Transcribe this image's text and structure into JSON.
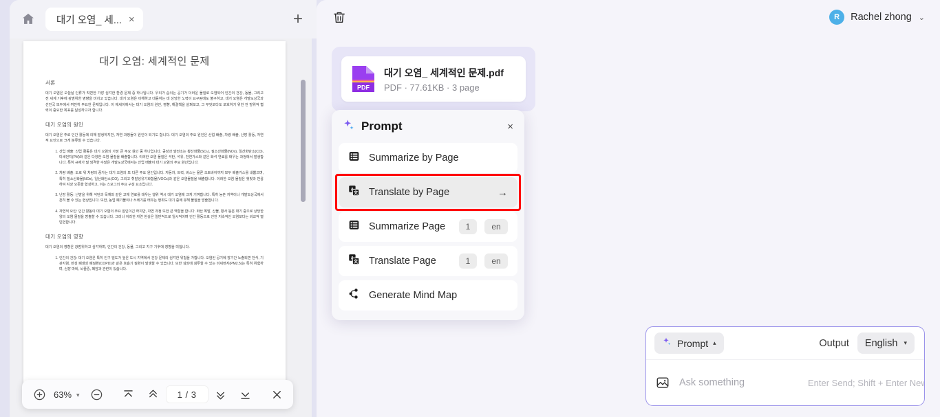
{
  "tabbar": {
    "home_icon": "home-icon",
    "tab_title": "대기 오염_ 세...",
    "tab_close": "×",
    "add_tab": "+"
  },
  "document": {
    "title": "대기 오염: 세계적인 문제",
    "sections": [
      {
        "heading": "서론",
        "paragraphs": [
          "대기 오염은 오늘날 인류가 직면한 가장 심각한 환경 문제 중 하나입니다. 우리가 숨쉬는 공기가 더러운 물질로 오염되어 인간의 건강, 동물, 그리고 전 세계 기후에 광범위한 영향을 미치고 있습니다. 대기 오염은 이해하고 대응하는 데 상당한 노력이 요구됨에도 불구하고, 대기 오염은 개발도상국과 선진국 모두에서 여전히 주요한 문제입니다. 이 에세이에서는 대기 오염의 원인, 영향, 해결책을 살펴보고, 그 무엇보다도 보호하기 위한 전 방위적 협력이 중요한 목표를 달성하고자 합니다."
        ],
        "list": []
      },
      {
        "heading": "대기 오염의 원인",
        "paragraphs": [
          "대기 오염은 주로 인간 활동에 의해 발생하지만, 자연 과정들이 원인이 되기도 합니다. 대기 오염의 주요 원인은 산업 배출, 차량 배출, 난방 활동, 자연적 요인으로 크게 분류할 수 있습니다."
        ],
        "list": [
          "산업 배출: 산업 활동은 대기 오염의 가장 큰 주요 원인 중 하나입니다. 공장과 발전소는 황산화물(SO₂), 질소산화물(NOx), 일산화탄소(CO), 미세먼지(PM)와 같은 다양한 오염 물질을 배출합니다. 이러한 오염 물질은 석탄, 석유, 천연가스와 같은 화석 연료를 태우는 과정에서 발생합니다. 특히 규제가 덜 엄격한 수많은 개발도상국에서는 산업 배출이 대기 오염의 주요 원인입니다.",
          "차량 배출: 도로 위 차량의 증가는 대기 오염의 또 다른 주요 원인입니다. 자동차, 트럭, 버스는 물론 오토바이까지 모두 배출가스를 내뿜으며, 특히 질소산화물(NOx), 일산화탄소(CO), 그리고 휘발성유기화합물(VOCs)과 같은 오염물질을 배출합니다. 이러한 오염 물질은 햇빛과 반응하여 지상 오존을 형성하고, 이는 스모그의 주요 구성 요소입니다.",
          "난방 활동: 난방을 위해 석탄과 목재와 같은 고체 연료를 태우는 행위 역시 대기 오염에 크게 기여합니다. 특히 농촌 지역이나 개발도상국에서 흔히 볼 수 있는 현상입니다. 또한, 농업 폐기물이나 쓰레기를 태우는 행위도 대기 중에 유해 물질을 방출합니다.",
          "자연적 요인: 인간 활동이 대기 오염의 주요 원인이긴 하지만, 자연 과정 또한 큰 역할을 합니다. 화산 폭발, 산불, 황사 등은 대기 중으로 상당한 양의 오염 물질을 방출할 수 있습니다. 그러나 이러한 자연 현상은 일반적으로 일시적이며 인간 활동으로 인한 지속적인 오염보다는 비교적 덜 빈번합니다."
        ]
      },
      {
        "heading": "대기 오염의 영향",
        "paragraphs": [
          "대기 오염의 영향은 광범위하고 심각하며, 인간의 건강, 동물, 그리고 지구 기후에 영향을 미칩니다."
        ],
        "list": [
          "인간의 건강: 대기 오염은 특히 인구 밀도가 높은 도시 지역에서 건강 문제의 심각한 위험을 가합니다. 오염된 공기에 장기간 노출되면 천식, 기관지염, 만성 폐쇄성 폐질환(COPD)과 같은 호흡기 질환이 발생할 수 있습니다. 또한 심장에 침투할 수 있는 미세먼지(PM2.5)는 특히 위험하며, 심장 마비, 뇌졸중, 폐암과 관련이 있습니다."
        ]
      }
    ]
  },
  "pdf_toolbar": {
    "zoom_in_icon": "zoom-in-icon",
    "zoom_level": "63%",
    "zoom_caret": "▾",
    "zoom_out_icon": "zoom-out-icon",
    "first_page_icon": "first-page-icon",
    "prev_page_icon": "prev-page-icon",
    "page_indicator": "1 / 3",
    "next_page_icon": "next-page-icon",
    "last_page_icon": "last-page-icon",
    "close_icon": "close-icon"
  },
  "right_header": {
    "trash_icon": "trash-icon",
    "avatar_initial": "R",
    "user_name": "Rachel zhong",
    "caret": "⌄"
  },
  "file_card": {
    "icon_label": "PDF",
    "name": "대기 오염_ 세계적인 문제.pdf",
    "meta": "PDF · 77.61KB · 3 page"
  },
  "prompt_panel": {
    "sparkle_icon": "sparkle-icon",
    "title": "Prompt",
    "close": "×",
    "items": [
      {
        "icon": "list-lines-icon",
        "label": "Summarize by Page",
        "arrow": "",
        "badges": []
      },
      {
        "icon": "translate-icon",
        "label": "Translate by Page",
        "arrow": "→",
        "badges": [],
        "highlighted": true
      },
      {
        "icon": "list-lines-icon",
        "label": "Summarize Page",
        "arrow": "",
        "badges": [
          "1",
          "en"
        ]
      },
      {
        "icon": "translate-icon",
        "label": "Translate Page",
        "arrow": "",
        "badges": [
          "1",
          "en"
        ]
      },
      {
        "icon": "mind-map-icon",
        "label": "Generate Mind Map",
        "arrow": "",
        "badges": []
      }
    ]
  },
  "composer": {
    "prompt_button_label": "Prompt",
    "prompt_button_caret": "▴",
    "output_label": "Output",
    "language_value": "English",
    "language_caret": "▾",
    "image_icon": "image-icon",
    "input_value": "",
    "input_placeholder": "Ask something",
    "hint": "Enter Send; Shift + Enter Newline",
    "send_icon": "send-icon"
  },
  "colors": {
    "accent_purple": "#9b93ea",
    "highlight_red": "#ff0000",
    "pdf_icon": "#9a3ff0",
    "avatar_blue": "#4db0e8",
    "right_bg": "#f5f4fa",
    "bubble_bg": "#e7e5f7"
  }
}
